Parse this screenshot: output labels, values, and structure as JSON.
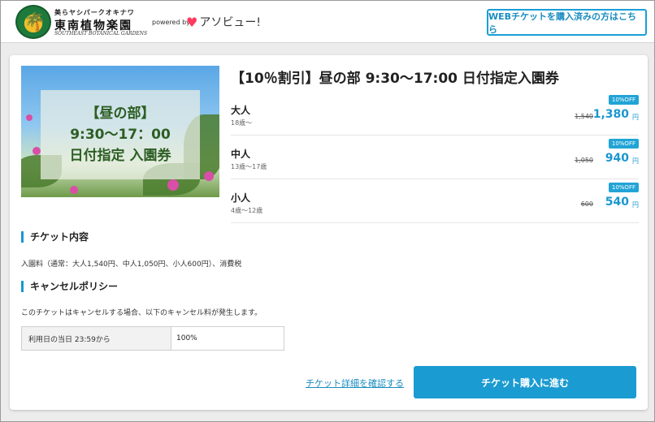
{
  "header": {
    "logo_kana": "美らヤシパークオキナワ",
    "logo_main": "東南植物楽園",
    "logo_en": "SOUTHEAST BOTANICAL GARDENS",
    "powered_by": "powered by",
    "asoview_name": "アソビュー!",
    "web_ticket_button": "WEBチケットを購入済みの方はこちら"
  },
  "ticket": {
    "image_text": [
      "【昼の部】",
      "9:30〜17：00",
      "日付指定 入園券"
    ],
    "title": "【10％割引】昼の部 9:30〜17:00 日付指定入園券",
    "prices": [
      {
        "label": "大人",
        "age": "18歳〜",
        "badge": "10%OFF",
        "old": "1,540",
        "new": "1,380",
        "unit": "円"
      },
      {
        "label": "中人",
        "age": "13歳〜17歳",
        "badge": "10%OFF",
        "old": "1,050",
        "new": "940",
        "unit": "円"
      },
      {
        "label": "小人",
        "age": "4歳〜12歳",
        "badge": "10%OFF",
        "old": "600",
        "new": "540",
        "unit": "円"
      }
    ]
  },
  "contents": {
    "heading": "チケット内容",
    "text": "入園料（通常：大人1,540円、中人1,050円、小人600円）、消費税"
  },
  "cancel": {
    "heading": "キャンセルポリシー",
    "text": "このチケットはキャンセルする場合、以下のキャンセル料が発生します。",
    "rows": [
      {
        "when": "利用日の当日 23:59から",
        "fee": "100%"
      }
    ]
  },
  "actions": {
    "detail_link": "チケット詳細を確認する",
    "buy_button": "チケット購入に進む"
  },
  "colors": {
    "accent": "#1a9bd1",
    "badge": "#21a4d6",
    "background": "#ececec"
  }
}
